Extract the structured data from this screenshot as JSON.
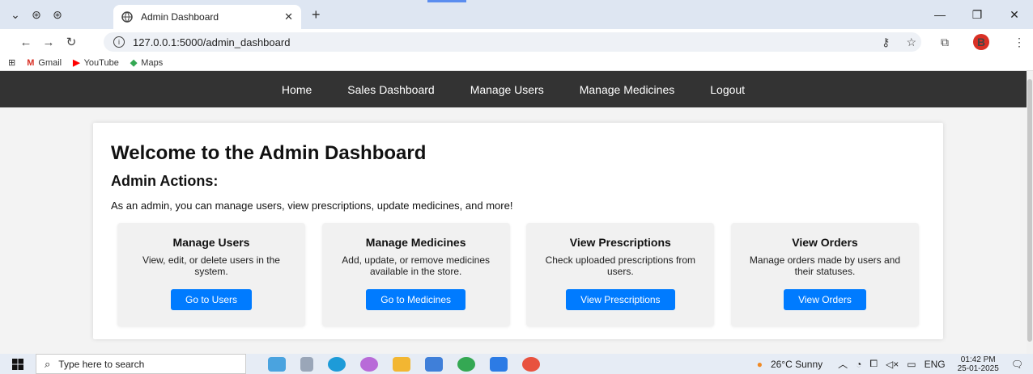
{
  "browser": {
    "tab_title": "Admin Dashboard",
    "url": "127.0.0.1:5000/admin_dashboard",
    "avatar_letter": "B",
    "bookmarks": [
      {
        "label": "Gmail",
        "icon": "gmail-icon"
      },
      {
        "label": "YouTube",
        "icon": "youtube-icon"
      },
      {
        "label": "Maps",
        "icon": "maps-icon"
      }
    ]
  },
  "nav": {
    "items": [
      "Home",
      "Sales Dashboard",
      "Manage Users",
      "Manage Medicines",
      "Logout"
    ]
  },
  "main": {
    "title": "Welcome to the Admin Dashboard",
    "subtitle": "Admin Actions:",
    "intro": "As an admin, you can manage users, view prescriptions, update medicines, and more!",
    "cards": [
      {
        "title": "Manage Users",
        "desc": "View, edit, or delete users in the system.",
        "button": "Go to Users"
      },
      {
        "title": "Manage Medicines",
        "desc": "Add, update, or remove medicines available in the store.",
        "button": "Go to Medicines"
      },
      {
        "title": "View Prescriptions",
        "desc": "Check uploaded prescriptions from users.",
        "button": "View Prescriptions"
      },
      {
        "title": "View Orders",
        "desc": "Manage orders made by users and their statuses.",
        "button": "View Orders"
      }
    ]
  },
  "taskbar": {
    "search_placeholder": "Type here to search",
    "weather": "26°C Sunny",
    "lang": "ENG",
    "time": "01:42 PM",
    "date": "25-01-2025"
  },
  "colors": {
    "nav_bg": "#333333",
    "button": "#007bff"
  }
}
